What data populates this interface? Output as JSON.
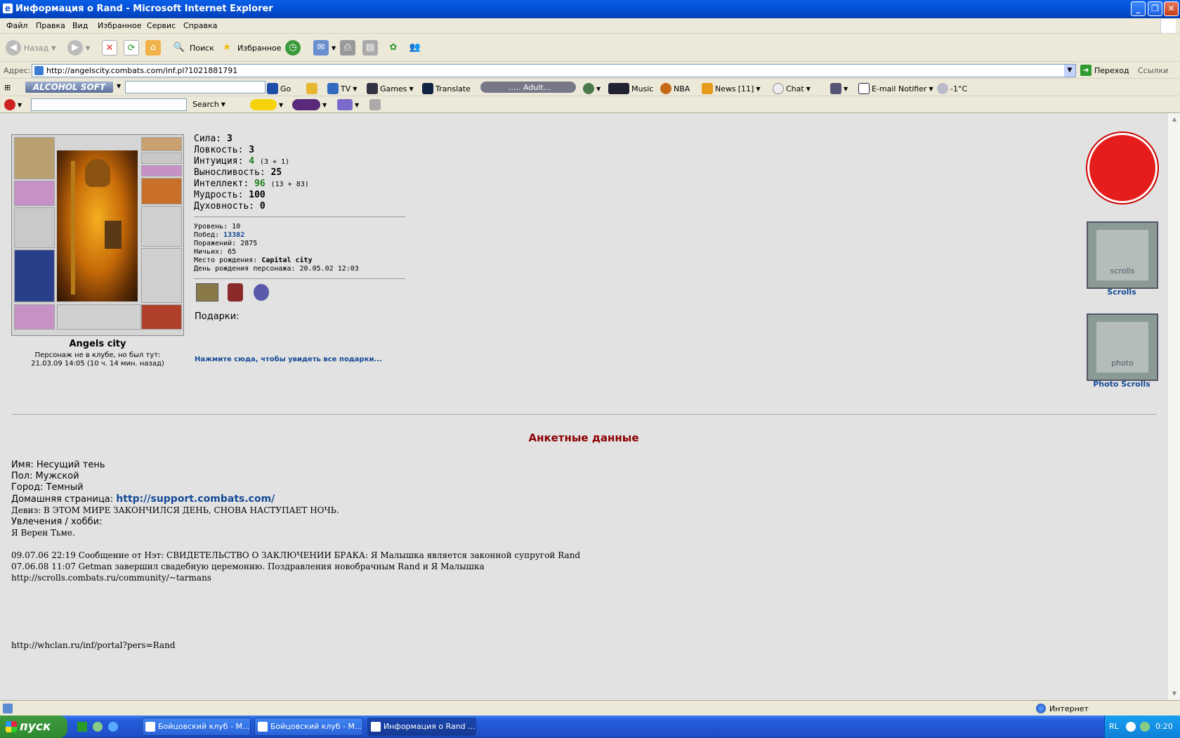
{
  "window": {
    "title": "Информация о Rand - Microsoft Internet Explorer"
  },
  "menu": [
    "Файл",
    "Правка",
    "Вид",
    "Избранное",
    "Сервис",
    "Справка"
  ],
  "toolbar": {
    "back": "Назад",
    "search": "Поиск",
    "favorites": "Избранное"
  },
  "address": {
    "label": "Адрес:",
    "url": "http://angelscity.combats.com/inf.pl?1021881791",
    "go": "Переход",
    "links": "Ссылки"
  },
  "alcohol": {
    "logo": "ALCOHOL SOFT",
    "go": "Go",
    "tv": "TV",
    "games": "Games",
    "translate": "Translate",
    "adult": "..... Adult...",
    "music": "Music",
    "nba": "NBA",
    "news": "News",
    "news_count": "[11]",
    "chat": "Chat",
    "email": "E-mail Notifier",
    "temp": "-1°C"
  },
  "toolbar4": {
    "search": "Search"
  },
  "character": {
    "city": "Angels city",
    "status_line1": "Персонаж не в клубе, но был тут:",
    "status_line2": "21.03.09 14:05 (10 ч. 14 мин. назад)",
    "stats": [
      {
        "label": "Сила:",
        "value": "3",
        "extra": ""
      },
      {
        "label": "Ловкость:",
        "value": "3",
        "extra": ""
      },
      {
        "label": "Интуиция:",
        "value": "4",
        "extra": "(3 + 1)"
      },
      {
        "label": "Выносливость:",
        "value": "25",
        "extra": ""
      },
      {
        "label": "Интеллект:",
        "value": "96",
        "extra": "(13 + 83)"
      },
      {
        "label": "Мудрость:",
        "value": "100",
        "extra": ""
      },
      {
        "label": "Духовность:",
        "value": "0",
        "extra": ""
      }
    ],
    "level": "Уровень: 10",
    "wins_label": "Побед:",
    "wins": "13382",
    "losses": "Поражений: 2875",
    "draws": "Ничьих: 65",
    "birthplace_label": "Место рождения:",
    "birthplace": "Capital city",
    "birthday": "День рождения персонажа: 20.05.02 12:03",
    "gifts": "Подарки:",
    "gifts_link": "Нажмите сюда, чтобы увидеть все подарки..."
  },
  "side": {
    "scrolls": "Scrolls",
    "banner1": "scrolls",
    "photo": "Photo Scrolls",
    "banner2": "photo"
  },
  "profile": {
    "title": "Анкетные данные",
    "name": "Имя: Несущий тень",
    "gender": "Пол: Мужской",
    "city": "Город: Темный",
    "homepage_label": "Домашняя страница:",
    "homepage": "http://support.combats.com/",
    "motto": "Девиз: В ЭТОМ МИРЕ ЗАКОНЧИЛСЯ ДЕНЬ, СНОВА НАСТУПАЕТ НОЧЬ.",
    "hobby": "Увлечения / хобби:",
    "hobby_text": "Я Верен Тьме.",
    "log1": "09.07.06 22:19 Сообщение от Нэт: СВИДЕТЕЛЬСТВО О ЗАКЛЮЧЕНИИ БРАКА: Я Малышка является законной супругой Rand",
    "log2": "07.06.08 11:07 Getman завершил свадебную церемонию. Поздравления новобрачным Rand и Я Малышка",
    "log3": "http://scrolls.combats.ru/community/~tarmans",
    "portal": "http://whclan.ru/inf/portal?pers=Rand"
  },
  "status": {
    "zone": "Интернет"
  },
  "taskbar": {
    "start": "пуск",
    "tasks": [
      "Бойцовский клуб - M...",
      "Бойцовский клуб - M...",
      "Информация о Rand ..."
    ],
    "lang": "RL",
    "clock": "0:20"
  }
}
